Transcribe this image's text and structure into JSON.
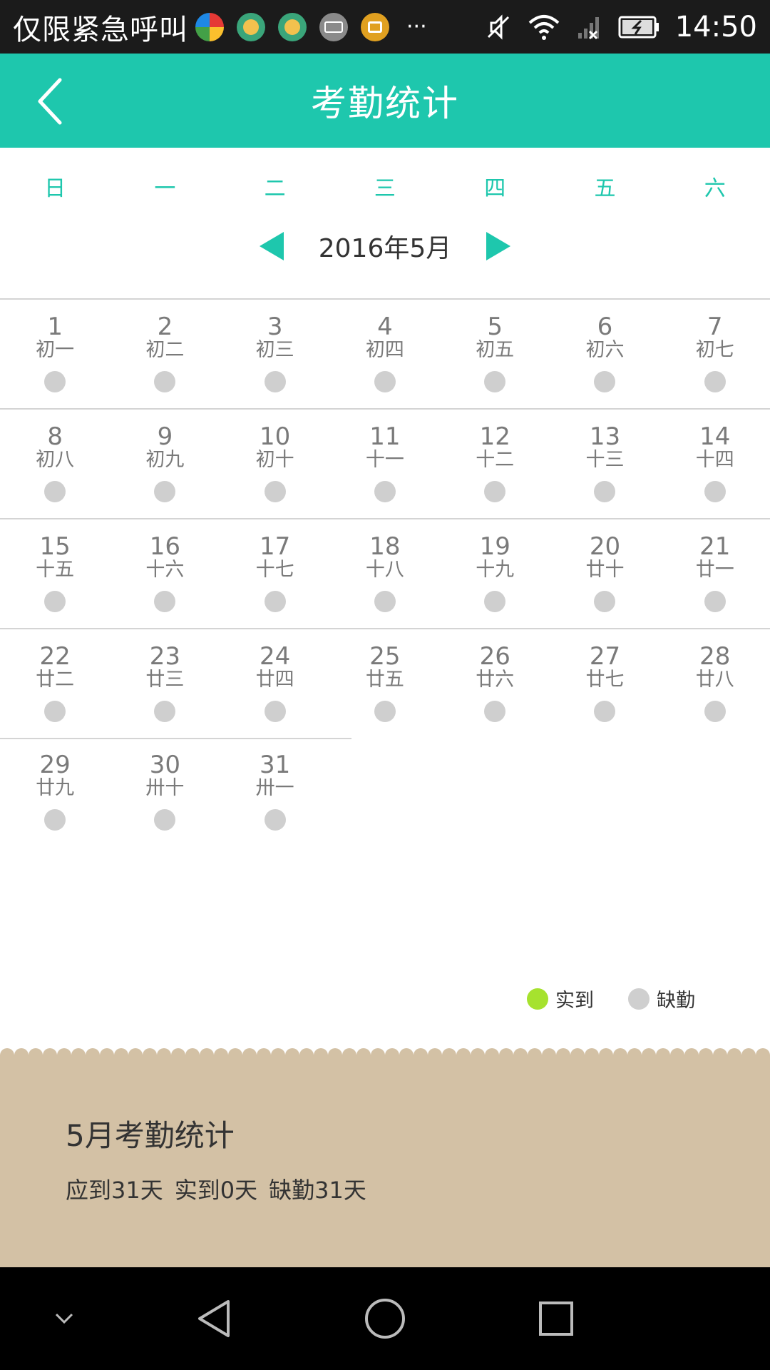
{
  "status_bar": {
    "carrier": "仅限紧急呼叫",
    "more": "···",
    "time": "14:50"
  },
  "header": {
    "title": "考勤统计"
  },
  "calendar": {
    "weekdays": [
      "日",
      "一",
      "二",
      "三",
      "四",
      "五",
      "六"
    ],
    "month_label": "2016年5月",
    "days": [
      {
        "num": "1",
        "lunar": "初一"
      },
      {
        "num": "2",
        "lunar": "初二"
      },
      {
        "num": "3",
        "lunar": "初三"
      },
      {
        "num": "4",
        "lunar": "初四"
      },
      {
        "num": "5",
        "lunar": "初五"
      },
      {
        "num": "6",
        "lunar": "初六"
      },
      {
        "num": "7",
        "lunar": "初七"
      },
      {
        "num": "8",
        "lunar": "初八"
      },
      {
        "num": "9",
        "lunar": "初九"
      },
      {
        "num": "10",
        "lunar": "初十"
      },
      {
        "num": "11",
        "lunar": "十一"
      },
      {
        "num": "12",
        "lunar": "十二"
      },
      {
        "num": "13",
        "lunar": "十三"
      },
      {
        "num": "14",
        "lunar": "十四"
      },
      {
        "num": "15",
        "lunar": "十五"
      },
      {
        "num": "16",
        "lunar": "十六"
      },
      {
        "num": "17",
        "lunar": "十七"
      },
      {
        "num": "18",
        "lunar": "十八"
      },
      {
        "num": "19",
        "lunar": "十九"
      },
      {
        "num": "20",
        "lunar": "廿十"
      },
      {
        "num": "21",
        "lunar": "廿一"
      },
      {
        "num": "22",
        "lunar": "廿二"
      },
      {
        "num": "23",
        "lunar": "廿三"
      },
      {
        "num": "24",
        "lunar": "廿四"
      },
      {
        "num": "25",
        "lunar": "廿五"
      },
      {
        "num": "26",
        "lunar": "廿六"
      },
      {
        "num": "27",
        "lunar": "廿七"
      },
      {
        "num": "28",
        "lunar": "廿八"
      },
      {
        "num": "29",
        "lunar": "廿九"
      },
      {
        "num": "30",
        "lunar": "卅十"
      },
      {
        "num": "31",
        "lunar": "卅一"
      }
    ]
  },
  "legend": {
    "present_label": "实到",
    "absent_label": "缺勤",
    "present_color": "#a6e22e",
    "absent_color": "#cfcfcf"
  },
  "summary": {
    "title": "5月考勤统计",
    "expected": "应到31天",
    "present": "实到0天",
    "absent": "缺勤31天"
  },
  "colors": {
    "accent": "#1ec7ad",
    "summary_bg": "#d3c1a5"
  }
}
